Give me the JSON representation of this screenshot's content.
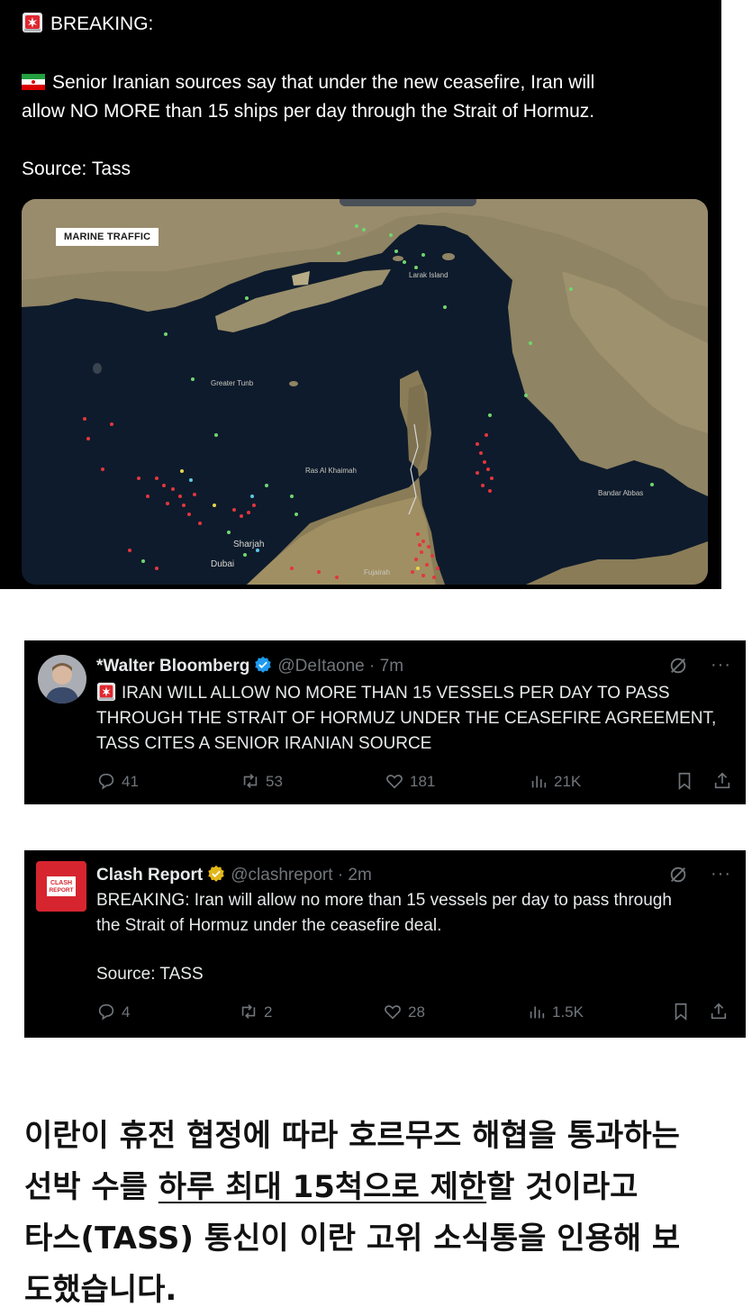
{
  "post1": {
    "breaking_label": "BREAKING:",
    "line1": "Senior Iranian sources say that under the new ceasefire, Iran will",
    "line2": "allow NO MORE than 15 ships per day through the Strait of Hormuz.",
    "source": "Source: Tass",
    "map": {
      "badge": "MARINE TRAFFIC",
      "labels": [
        "Greater Tunb",
        "Ras Al Khaimah",
        "Sharjah",
        "Dubai",
        "Fujairah",
        "Bandar Abbas",
        "Larak Island"
      ]
    }
  },
  "tweet1": {
    "name": "*Walter Bloomberg",
    "handle": "@DeItaone",
    "time": "· 7m",
    "more": "···",
    "lines": [
      "IRAN WILL ALLOW NO MORE THAN 15 VESSELS PER DAY TO PASS",
      "THROUGH THE STRAIT OF HORMUZ UNDER THE CEASEFIRE AGREEMENT,",
      "TASS CITES A SENIOR IRANIAN SOURCE"
    ],
    "replies": "41",
    "reposts": "53",
    "likes": "181",
    "views": "21K"
  },
  "tweet2": {
    "name": "Clash Report",
    "handle": "@clashreport",
    "time": "· 2m",
    "more": "···",
    "avatar_text": "CLASH REPORT",
    "lines": [
      "BREAKING: Iran will allow no more than 15 vessels per day to pass through",
      "the Strait of Hormuz under the ceasefire deal."
    ],
    "source": "Source: TASS",
    "replies": "4",
    "reposts": "2",
    "likes": "28",
    "views": "1.5K"
  },
  "caption": {
    "line1": "이란이 휴전 협정에 따라 호르무즈 해협을 통과하는",
    "line2_a": "선박 수를 ",
    "line2_u": "하루 최대 15척으로 제한",
    "line2_b": "할 것이라고",
    "line3": "타스(TASS) 통신이 이란 고위 소식통을 인용해 보",
    "line4": "도했습니다."
  },
  "colors": {
    "background": "#ffffff",
    "post": "#000000",
    "text": "#e7e9ea",
    "muted": "#71767b",
    "verified_blue": "#1d9bf0",
    "verified_gold": "#e2b719",
    "clash_red": "#d6252f"
  }
}
